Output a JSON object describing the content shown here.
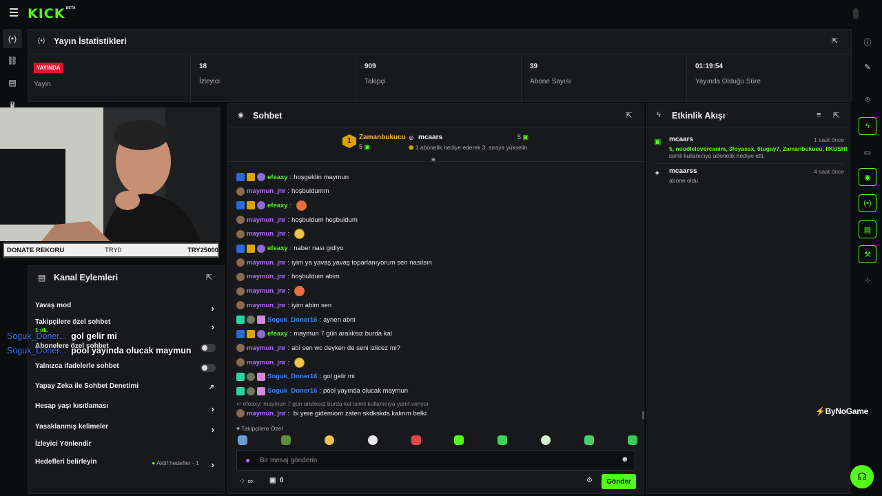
{
  "brand": {
    "logo": "KICK",
    "logo_tag": "BETA",
    "accent": "#53fc18"
  },
  "stats": {
    "title": "Yayın İstatistikleri",
    "live_badge": "YAYINDA",
    "live_label": "Yayın",
    "viewers": {
      "value": "18",
      "label": "İzleyici"
    },
    "followers": {
      "value": "909",
      "label": "Takipçi"
    },
    "subscribers": {
      "value": "39",
      "label": "Abone Sayısı"
    },
    "uptime": {
      "value": "01:19:54",
      "label": "Yayında Olduğu Süre"
    }
  },
  "donate": {
    "label": "DONATE REKORU",
    "amount_left": "TRY0",
    "amount_right": "TRY25000"
  },
  "actions": {
    "title": "Kanal Eylemleri",
    "items": [
      {
        "label": "Yavaş mod"
      },
      {
        "label": "Takipçilere özel sohbet",
        "sub": "1 dk."
      },
      {
        "label": "Abonelere özel sohbet"
      },
      {
        "label": "Yalnızca ifadelerle sohbet"
      },
      {
        "label": "Yapay Zeka ile Sohbet Denetimi"
      },
      {
        "label": "Hesap yaşı kısıtlaması"
      },
      {
        "label": "Yasaklanmış kelimeler"
      },
      {
        "label": "İzleyici Yönlendir"
      },
      {
        "label": "Hedefleri belirleyin",
        "status": "Aktif hedefler - 1"
      }
    ]
  },
  "overlay": [
    {
      "user": "Soguk_Doner...",
      "text": "gol gelir mi"
    },
    {
      "user": "Soguk_Doner...",
      "text": "pool yayında olucak maymun"
    }
  ],
  "chat": {
    "title": "Sohbet",
    "leaderboard": {
      "first": {
        "rank": "1",
        "name": "Zamanbukucu",
        "count": "5"
      },
      "second": {
        "name": "mcaars",
        "count": "5",
        "note": "1 abonelik hediye ederek 3. sıraya yükselin"
      }
    },
    "messages": [
      {
        "user": "efeaxy",
        "text": "hoşgeldin maymun",
        "color": "green",
        "badges": [
          "blue",
          "gold",
          "pur"
        ]
      },
      {
        "user": "maymun_jnr",
        "text": "hoşbuldumm",
        "color": "purple",
        "badges": [
          "brown"
        ]
      },
      {
        "user": "efeaxy",
        "text": "",
        "color": "green",
        "badges": [
          "blue",
          "gold",
          "pur"
        ],
        "emote": "red"
      },
      {
        "user": "maymun_jnr",
        "text": "hoşbuldum hoşbuldum",
        "color": "purple",
        "badges": [
          "brown"
        ]
      },
      {
        "user": "maymun_jnr",
        "text": "",
        "color": "purple",
        "badges": [
          "brown"
        ],
        "emote": "yellow"
      },
      {
        "user": "efeaxy",
        "text": "naber nası gidiyo",
        "color": "green",
        "badges": [
          "blue",
          "gold",
          "pur"
        ]
      },
      {
        "user": "maymun_jnr",
        "text": "iyim ya yavaş yavaş toparlanıyorum sen nasılsın",
        "color": "purple",
        "badges": [
          "brown"
        ]
      },
      {
        "user": "maymun_jnr",
        "text": "hoşbuldum abim",
        "color": "purple",
        "badges": [
          "brown"
        ]
      },
      {
        "user": "maymun_jnr",
        "text": "",
        "color": "purple",
        "badges": [
          "brown"
        ],
        "emote": "red"
      },
      {
        "user": "maymun_jnr",
        "text": "iyim abim sen",
        "color": "purple",
        "badges": [
          "brown"
        ]
      },
      {
        "user": "Soguk_Doner16",
        "text": "aynen abni",
        "color": "blue",
        "badges": [
          "teal",
          "gray",
          "pink"
        ]
      },
      {
        "user": "efeaxy",
        "text": "maymun 7 gün aralıksız burda kal",
        "color": "green",
        "badges": [
          "blue",
          "gold",
          "pur"
        ]
      },
      {
        "user": "maymun_jnr",
        "text": "abi sen wc deyken de seni izlicez mi?",
        "color": "purple",
        "badges": [
          "brown"
        ]
      },
      {
        "user": "maymun_jnr",
        "text": "",
        "color": "purple",
        "badges": [
          "brown"
        ],
        "emote": "yellow"
      },
      {
        "user": "Soguk_Doner16",
        "text": "gol gelir mi",
        "color": "blue",
        "badges": [
          "teal",
          "gray",
          "pink"
        ]
      },
      {
        "user": "Soguk_Doner16",
        "text": "pool yayında olucak maymun",
        "color": "blue",
        "badges": [
          "teal",
          "gray",
          "pink"
        ]
      }
    ],
    "reply_context": "efeaxy: maymun 7 gün aralıksız burda kal isimli kullanıcıya yanıt veriyor",
    "reply": {
      "user": "maymun_jnr",
      "text": "bi yere gidemiom zaten skdkskds kalırım belki"
    },
    "emote_section": "Takipçilere Özel",
    "input_placeholder": "Bir mesaj gönderin",
    "points_label": "∞",
    "gift_count": "0",
    "send_label": "Gönder"
  },
  "activity": {
    "title": "Etkinlik Akışı",
    "events": [
      {
        "name": "mcaars",
        "time": "1 saat önce",
        "highlight": "5, noodlelovercanim, 3foyassx, 6tugay7, Zamanbukucu, IIKUSHI",
        "detail": "isimli kullanıcıya abonelik hediye etti."
      },
      {
        "name": "mcaarss",
        "time": "4 saat önce",
        "highlight": "",
        "detail": "abone oldu"
      }
    ]
  },
  "watermark": "ByNoGame"
}
